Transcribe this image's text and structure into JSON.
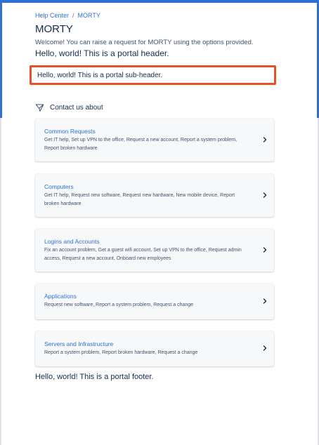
{
  "breadcrumb": {
    "items": [
      "Help Center",
      "MORTY"
    ],
    "separator": "/"
  },
  "portal": {
    "title": "MORTY",
    "welcome": "Welcome! You can raise a request for MORTY using the options provided.",
    "header": "Hello, world! This is a portal header.",
    "subheader": "Hello, world! This is a portal sub-header.",
    "footer": "Hello, world! This is a portal footer."
  },
  "contact": {
    "icon": "paper-plane-icon",
    "label": "Contact us about"
  },
  "groups": [
    {
      "title": "Common Requests",
      "desc": "Get IT help, Set up VPN to the office, Request a new account, Report a system problem, Report broken hardware"
    },
    {
      "title": "Computers",
      "desc": "Get IT help, Request new software, Request new hardware, New mobile device, Report broken hardware"
    },
    {
      "title": "Logins and Accounts",
      "desc": "Fix an account problem, Get a guest wifi account, Set up VPN to the office, Request admin access, Request a new account, Onboard new employees"
    },
    {
      "title": "Applications",
      "desc": "Request new software, Report a system problem, Request a change"
    },
    {
      "title": "Servers and Infrastructure",
      "desc": "Report a system problem, Report broken hardware, Request a change"
    }
  ],
  "colors": {
    "accent": "#2f6fd6",
    "highlight": "#e6502c",
    "text": "#172b4d"
  }
}
